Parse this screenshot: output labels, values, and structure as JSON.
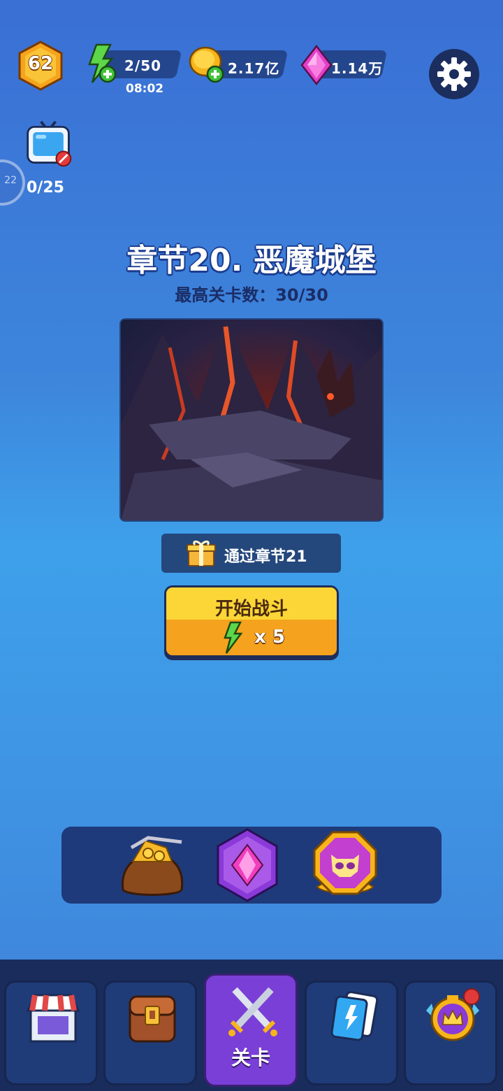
{
  "player": {
    "level": "62"
  },
  "resources": {
    "energy": {
      "value": "2/50",
      "timer": "08:02",
      "icon": "lightning-plus-icon"
    },
    "gold": {
      "value": "2.17亿",
      "icon": "gold-coin-plus-icon"
    },
    "gems": {
      "value": "1.14万",
      "icon": "pink-gem-icon"
    }
  },
  "ad_reward": {
    "count": "0/25",
    "icon": "tv-icon"
  },
  "side_indicator": {
    "text": "22"
  },
  "chapter": {
    "title": "章节20. 恶魔城堡",
    "subtitle": "最高关卡数：30/30",
    "reward_text": "通过章节21"
  },
  "start_button": {
    "label": "开始战斗",
    "cost": "x 5"
  },
  "quick_items": [
    "treasure-bag-icon",
    "gem-shop-icon",
    "skull-badge-icon"
  ],
  "nav": {
    "active_label": "关卡",
    "tabs": [
      "shop-icon",
      "backpack-icon",
      "crossed-swords-icon",
      "cards-icon",
      "crown-shield-icon"
    ]
  },
  "colors": {
    "accent_gold": "#fbd636",
    "active_tab": "#7a3fd6",
    "panel": "#1e3a7a"
  }
}
